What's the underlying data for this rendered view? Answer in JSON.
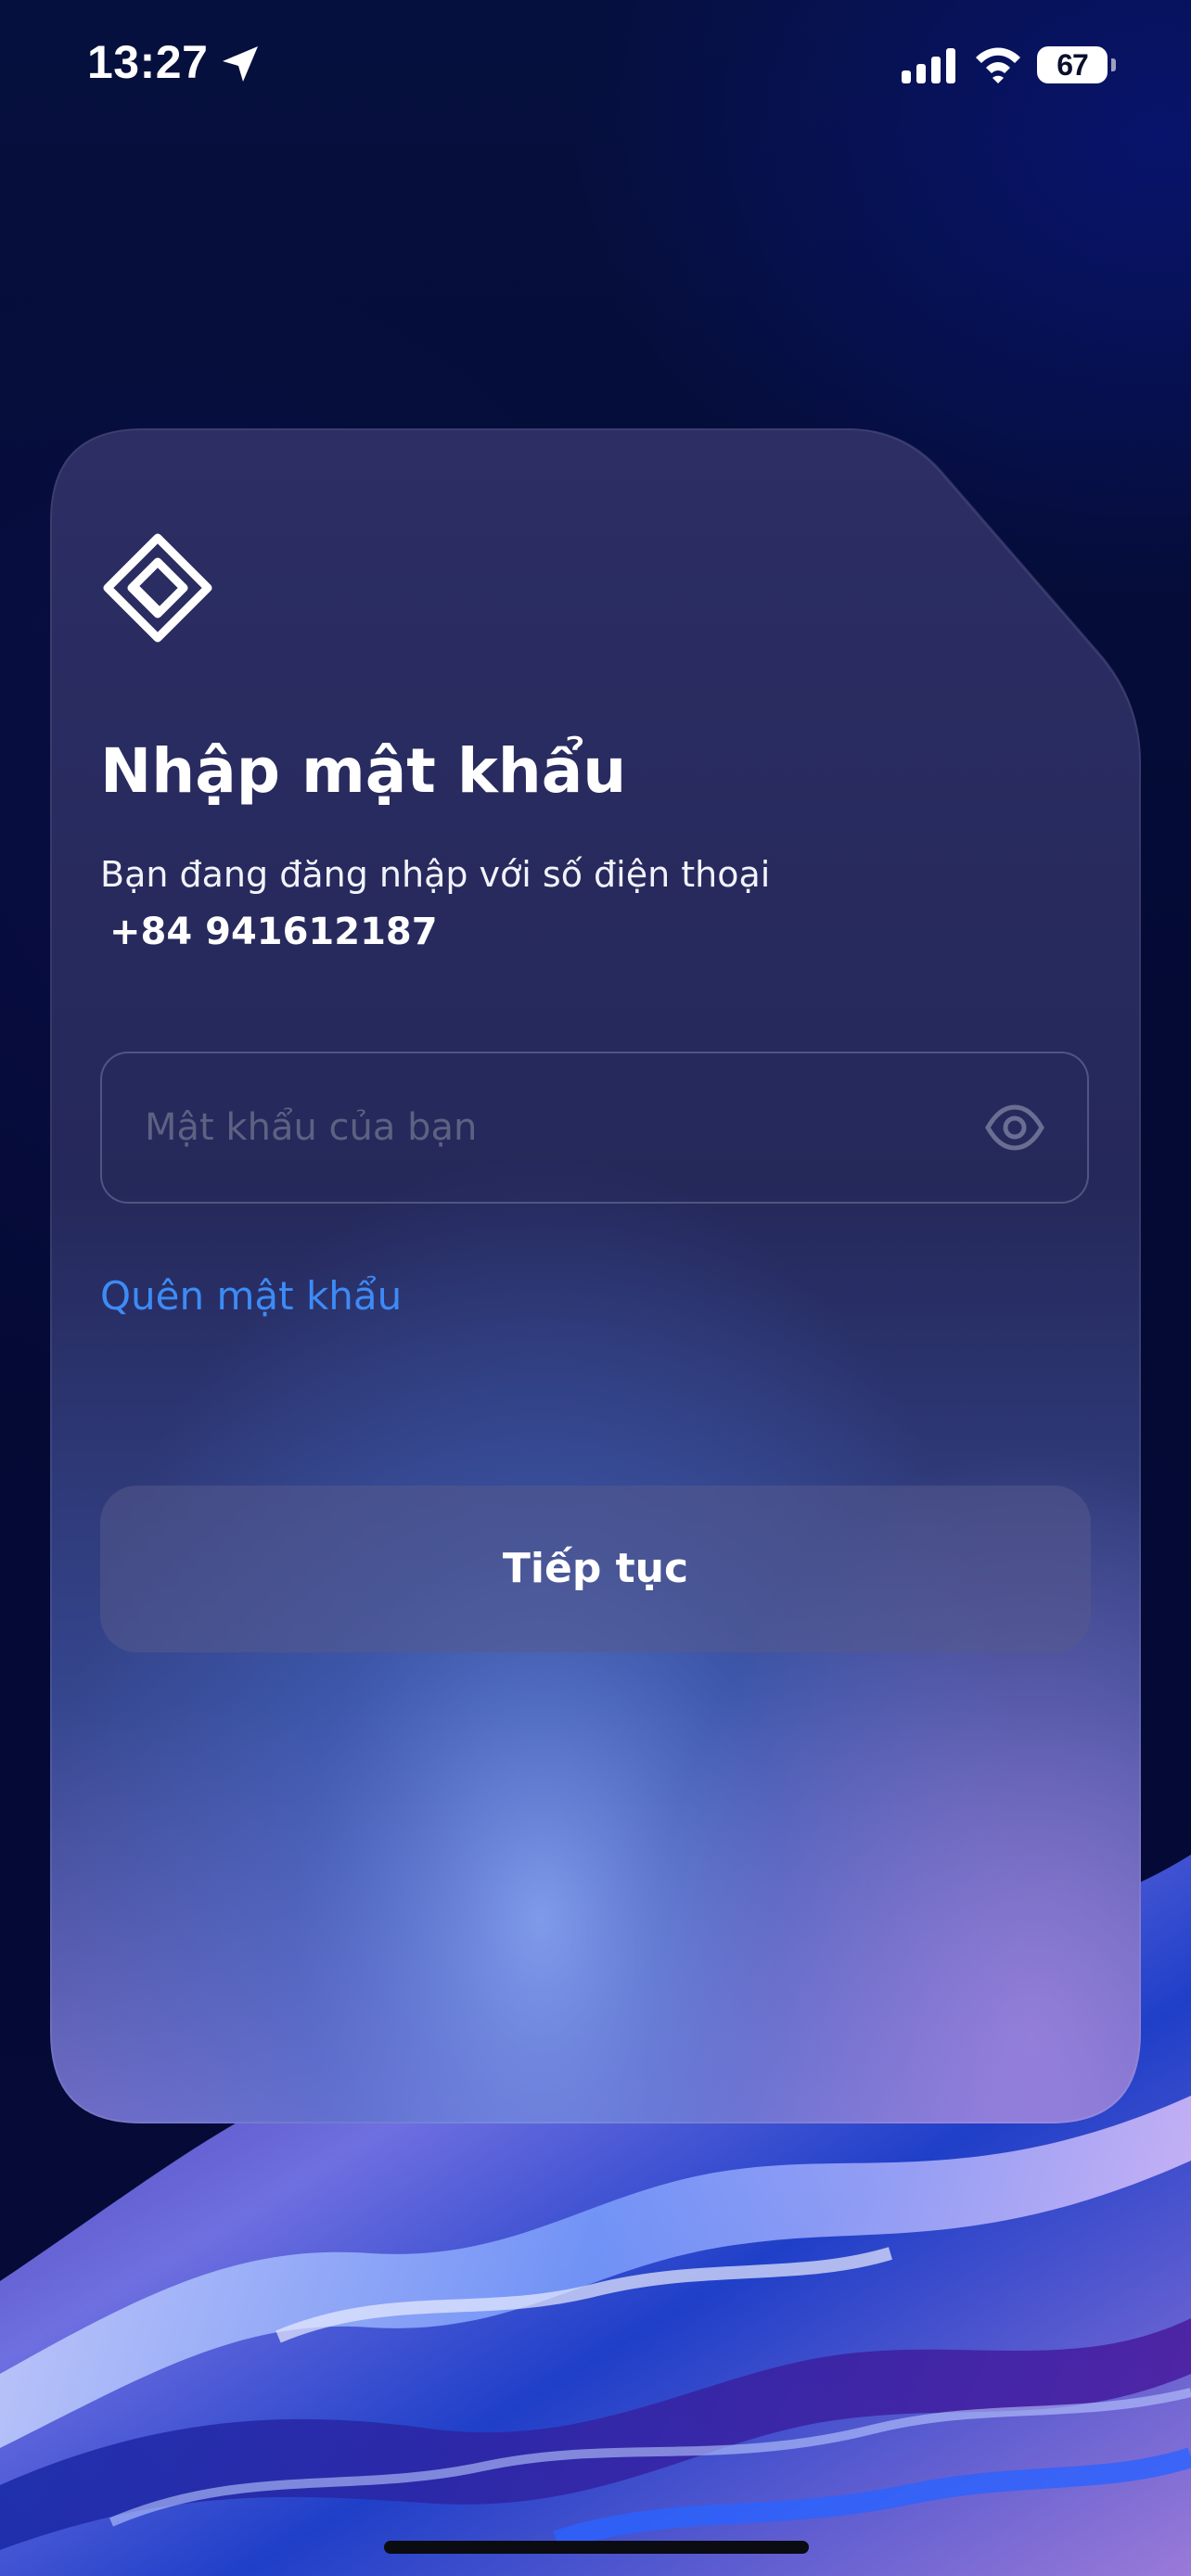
{
  "status_bar": {
    "time": "13:27",
    "battery": "67",
    "icons": [
      "location-arrow-icon",
      "cellular-signal-icon",
      "wifi-icon",
      "battery-icon"
    ]
  },
  "card": {
    "logo_icon": "diamond-logo-icon",
    "title": "Nhập mật khẩu",
    "subtitle": "Bạn đang đăng nhập với số điện thoại",
    "phone": "+84 941612187",
    "password": {
      "value": "",
      "placeholder": "Mật khẩu của bạn",
      "toggle_icon": "eye-icon"
    },
    "forgot_link": "Quên mật khẩu",
    "continue_button": "Tiếp tục"
  },
  "colors": {
    "background": "#050b36",
    "link": "#3d8bf5",
    "button": "#4a4e80",
    "placeholder": "#5d6182"
  }
}
